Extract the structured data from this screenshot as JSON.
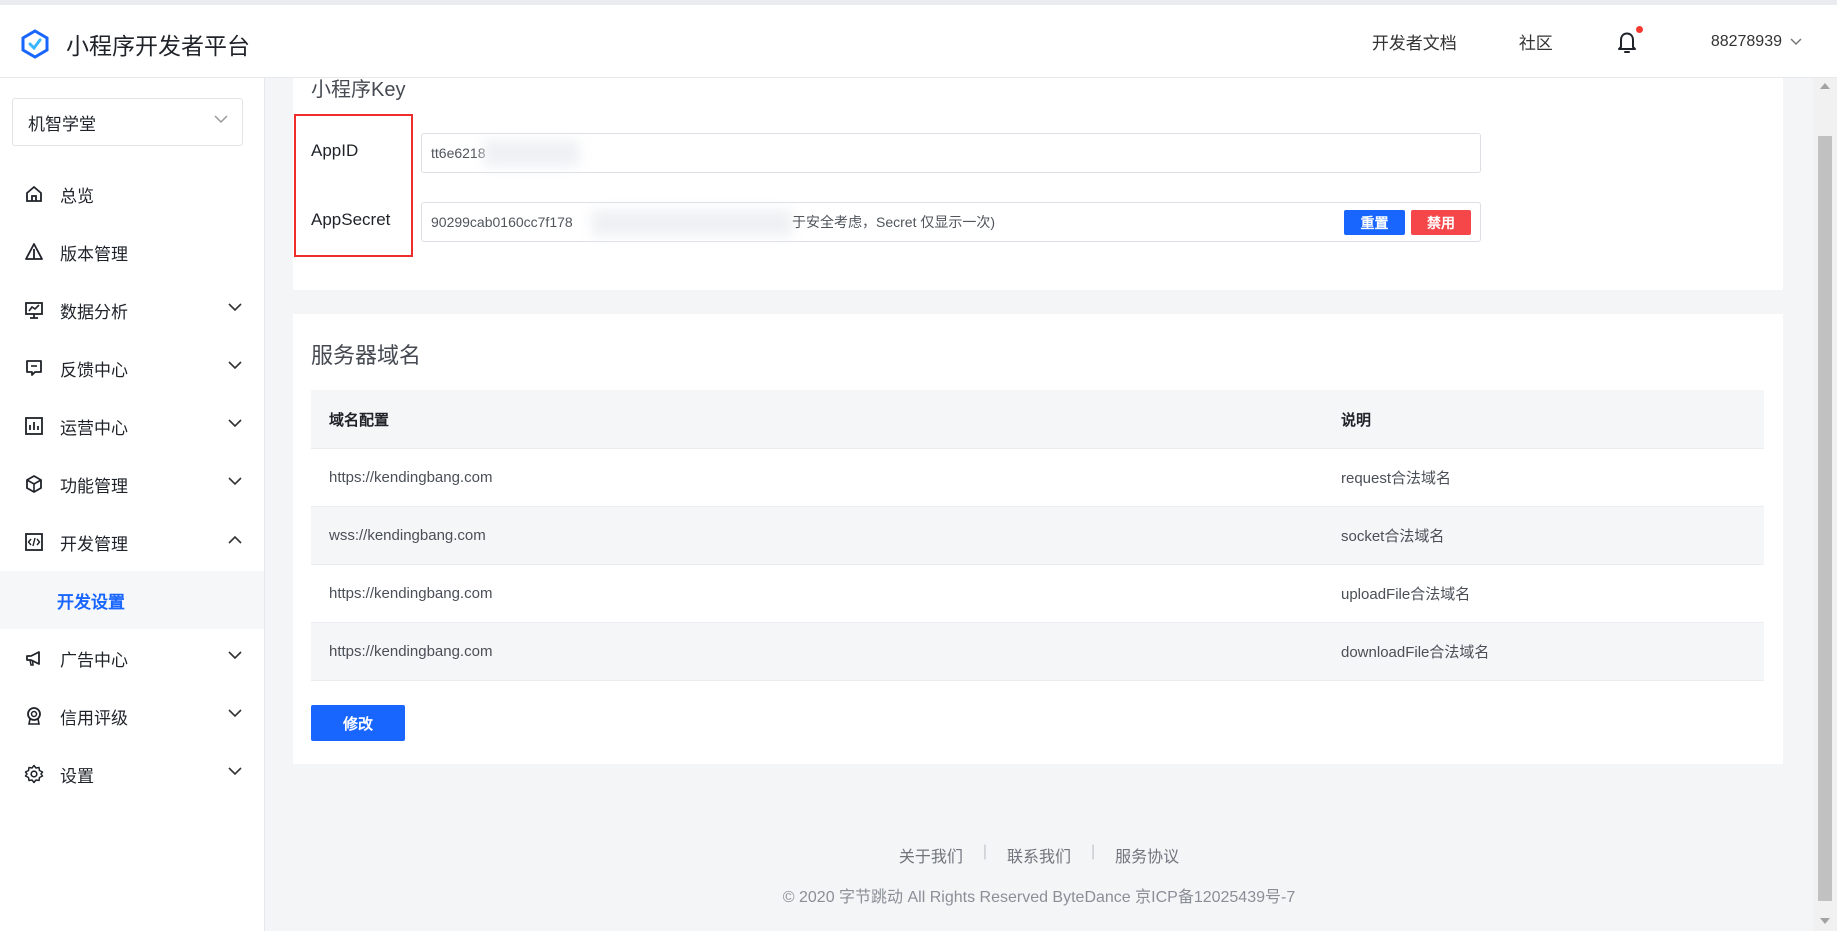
{
  "header": {
    "title": "小程序开发者平台",
    "nav_docs": "开发者文档",
    "nav_community": "社区",
    "account_id": "88278939"
  },
  "sidebar": {
    "app_name": "机智学堂",
    "items": [
      {
        "label": "总览",
        "icon": "home-icon"
      },
      {
        "label": "版本管理",
        "icon": "version-icon"
      },
      {
        "label": "数据分析",
        "icon": "chart-icon"
      },
      {
        "label": "反馈中心",
        "icon": "feedback-icon"
      },
      {
        "label": "运营中心",
        "icon": "operation-icon"
      },
      {
        "label": "功能管理",
        "icon": "cube-icon"
      },
      {
        "label": "开发管理",
        "icon": "code-icon"
      },
      {
        "label": "开发设置",
        "icon": ""
      },
      {
        "label": "广告中心",
        "icon": "megaphone-icon"
      },
      {
        "label": "信用评级",
        "icon": "badge-icon"
      },
      {
        "label": "设置",
        "icon": "gear-icon"
      }
    ]
  },
  "keys": {
    "title": "小程序Key",
    "appid_label": "AppID",
    "appid_value": "tt6e6218",
    "secret_label": "AppSecret",
    "secret_value": "90299cab0160cc7f178",
    "secret_note": "于安全考虑，Secret 仅显示一次)",
    "reset_label": "重置",
    "disable_label": "禁用"
  },
  "domains": {
    "title": "服务器域名",
    "columns": [
      "域名配置",
      "说明"
    ],
    "rows": [
      [
        "https://kendingbang.com",
        "request合法域名"
      ],
      [
        "wss://kendingbang.com",
        "socket合法域名"
      ],
      [
        "https://kendingbang.com",
        "uploadFile合法域名"
      ],
      [
        "https://kendingbang.com",
        "downloadFile合法域名"
      ]
    ],
    "edit_label": "修改"
  },
  "footer": {
    "about": "关于我们",
    "contact": "联系我们",
    "terms": "服务协议",
    "copyright": "© 2020 字节跳动 All Rights Reserved ByteDance 京ICP备12025439号-7"
  },
  "colors": {
    "primary": "#1966ff",
    "danger": "#f5474a",
    "highlight_box": "#ee2d2d"
  }
}
